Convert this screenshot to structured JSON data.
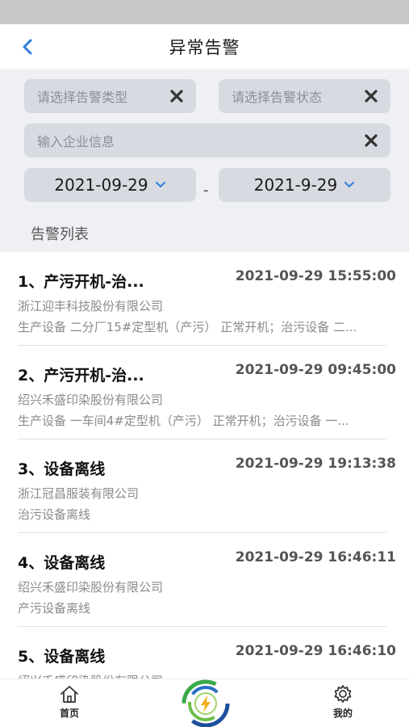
{
  "nav": {
    "title": "异常告警",
    "back_icon": "chevron-left-icon"
  },
  "filters": {
    "alarm_type_placeholder": "请选择告警类型",
    "alarm_status_placeholder": "请选择告警状态",
    "company_placeholder": "输入企业信息",
    "start_date": "2021-09-29",
    "end_date": "2021-9-29",
    "date_separator": "-",
    "clear_icon": "close-icon"
  },
  "list_header": "告警列表",
  "alarms": [
    {
      "title": "1、产污开机-治...",
      "time": "2021-09-29 15:55:00",
      "company": "浙江迎丰科技股份有限公司",
      "detail": "生产设备  二分厂15#定型机（产污） 正常开机；治污设备 二..."
    },
    {
      "title": "2、产污开机-治...",
      "time": "2021-09-29 09:45:00",
      "company": "绍兴禾盛印染股份有限公司",
      "detail": "生产设备  一车间4#定型机（产污） 正常开机；治污设备 一..."
    },
    {
      "title": "3、设备离线",
      "time": "2021-09-29 19:13:38",
      "company": "浙江冠昌服装有限公司",
      "detail": "治污设备离线"
    },
    {
      "title": "4、设备离线",
      "time": "2021-09-29 16:46:11",
      "company": "绍兴禾盛印染股份有限公司",
      "detail": "产污设备离线"
    },
    {
      "title": "5、设备离线",
      "time": "2021-09-29 16:46:10",
      "company": "绍兴禾盛印染股份有限公司",
      "detail": ""
    }
  ],
  "tabbar": {
    "home_label": "首页",
    "home_icon": "home-icon",
    "center_icon": "app-logo-icon",
    "mine_label": "我的",
    "mine_icon": "gear-icon"
  },
  "colors": {
    "accent": "#2f7de1",
    "filter_bg": "#eef0f3",
    "pill_bg": "#d7dae0"
  }
}
